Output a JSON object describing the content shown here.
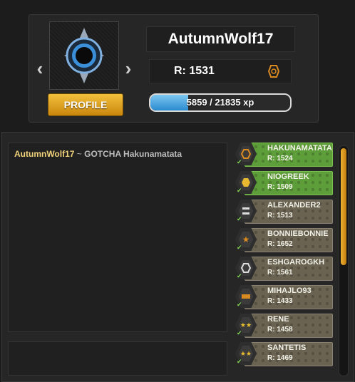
{
  "profile": {
    "username": "AutumnWolf17",
    "rating_label": "R: 1531",
    "profile_button": "PROFILE",
    "xp_text": "5859 / 21835 xp",
    "xp_progress": 0.268,
    "prev_arrow": "‹",
    "next_arrow": "›"
  },
  "chat": {
    "messages": [
      {
        "author": "AutumnWolf17",
        "separator": " ~ ",
        "text": "GOTCHA Hakunamatata"
      }
    ]
  },
  "players": [
    {
      "name": "HAKUNAMATATA",
      "rating": "R: 1524",
      "status": "online",
      "icon": "hex-ring-icon"
    },
    {
      "name": "NIOGREEK",
      "rating": "R: 1509",
      "status": "online",
      "icon": "gold-hex-icon"
    },
    {
      "name": "ALEXANDER2",
      "rating": "R: 1513",
      "status": "idle",
      "icon": "bars-icon"
    },
    {
      "name": "BONNIEBONNIE",
      "rating": "R: 1652",
      "status": "idle",
      "icon": "star-icon"
    },
    {
      "name": "ESHGAROGKH",
      "rating": "R: 1561",
      "status": "idle",
      "icon": "ring-icon"
    },
    {
      "name": "MIHAJLO93",
      "rating": "R: 1433",
      "status": "idle",
      "icon": "bar-icon"
    },
    {
      "name": "RENE",
      "rating": "R: 1458",
      "status": "idle",
      "icon": "stars-icon"
    },
    {
      "name": "SANTETIS",
      "rating": "R: 1469",
      "status": "idle",
      "icon": "stars-icon"
    }
  ],
  "colors": {
    "accent_gold": "#f3c13c",
    "online_green": "#5e9e3a",
    "idle_tan": "#6a6352",
    "xp_blue": "#2a8ad0"
  }
}
